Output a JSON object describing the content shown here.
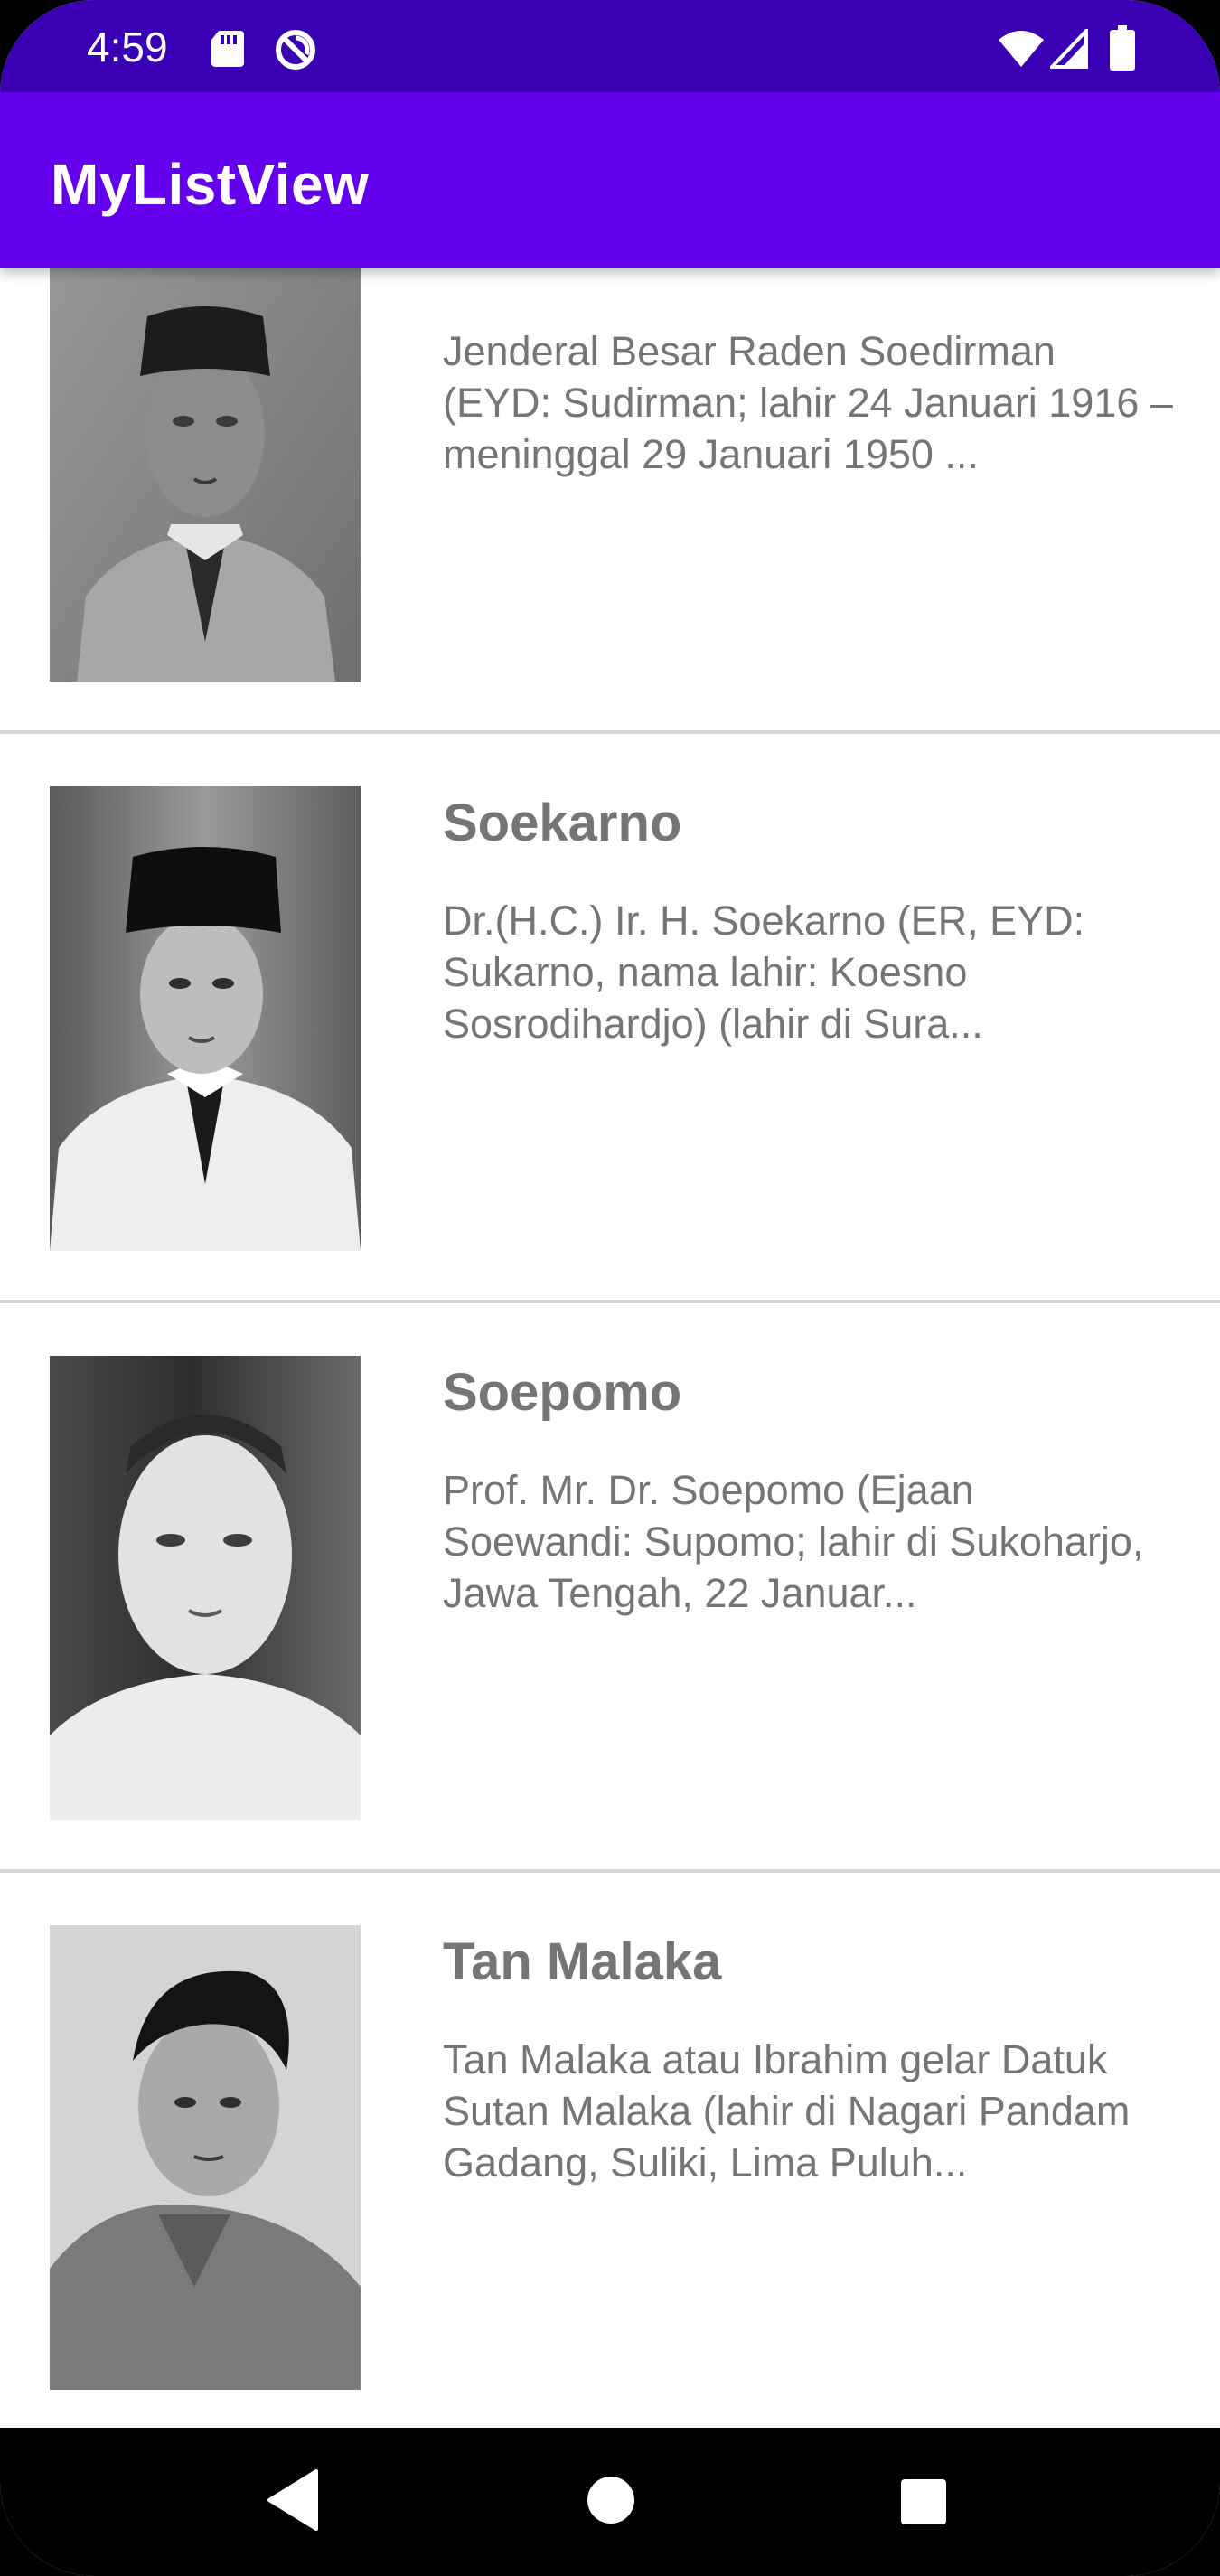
{
  "status_bar": {
    "time": "4:59",
    "background": "#3a00b3",
    "icons": [
      "sd-card-icon",
      "sync-off-icon",
      "wifi-icon",
      "signal-icon",
      "battery-icon"
    ]
  },
  "app_bar": {
    "title": "MyListView",
    "background": "#6200ee"
  },
  "heroes": [
    {
      "name": "",
      "description": "Jenderal Besar Raden Soedirman (EYD: Sudirman; lahir 24 Januari 1916 – meninggal 29 Januari 1950 ..."
    },
    {
      "name": "Soekarno",
      "description": "Dr.(H.C.) Ir. H. Soekarno (ER, EYD: Sukarno, nama lahir: Koesno Sosrodihardjo) (lahir di Sura..."
    },
    {
      "name": "Soepomo",
      "description": "Prof. Mr. Dr. Soepomo (Ejaan Soewandi: Supomo; lahir di Sukoharjo, Jawa Tengah, 22 Januar..."
    },
    {
      "name": "Tan Malaka",
      "description": "Tan Malaka atau Ibrahim gelar Datuk Sutan Malaka (lahir di Nagari Pandam Gadang, Suliki, Lima Puluh..."
    }
  ],
  "nav_bar": {
    "icons": [
      "back-icon",
      "home-icon",
      "recent-apps-icon"
    ]
  }
}
